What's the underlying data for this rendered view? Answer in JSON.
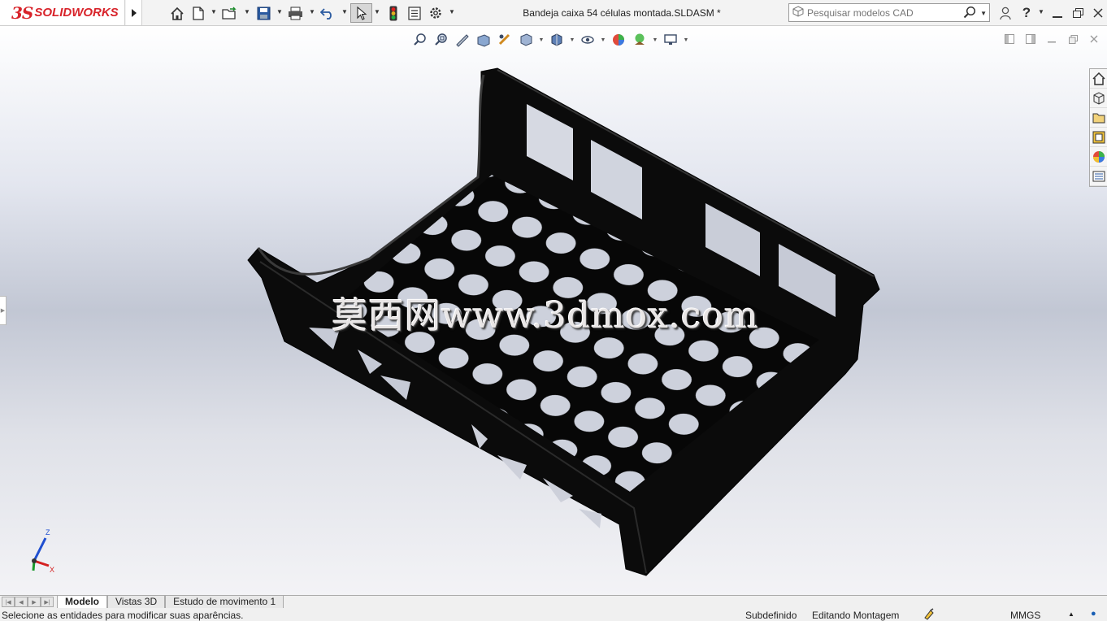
{
  "app": {
    "logo_ds": "3S",
    "logo_text": "SOLIDWORKS",
    "document_title": "Bandeja caixa 54 células montada.SLDASM *"
  },
  "toolbar": {
    "icons": [
      "home-icon",
      "new-document-icon",
      "open-icon",
      "save-icon",
      "print-icon",
      "undo-icon",
      "select-icon",
      "rebuild-icon",
      "file-properties-icon",
      "options-icon"
    ]
  },
  "search": {
    "placeholder": "Pesquisar modelos CAD"
  },
  "heads_up_toolbar": {
    "icons": [
      "zoom-to-fit-icon",
      "zoom-to-area-icon",
      "previous-view-icon",
      "section-view-icon",
      "dynamic-annotation-icon",
      "view-orientation-icon",
      "display-style-icon",
      "hide-show-items-icon",
      "edit-appearance-icon",
      "apply-scene-icon",
      "view-settings-icon"
    ]
  },
  "task_pane": {
    "icons": [
      "solidworks-resources-icon",
      "design-library-icon",
      "file-explorer-icon",
      "view-palette-icon",
      "appearances-icon",
      "custom-properties-icon"
    ]
  },
  "watermark": "莫西网www.3dmox.com",
  "triad": {
    "z_label": "Z",
    "x_label": "X",
    "colors": {
      "z": "#1f4fd0",
      "x": "#d42020",
      "y": "#1a9a2a"
    }
  },
  "tabs": [
    {
      "label": "Modelo",
      "active": true
    },
    {
      "label": "Vistas 3D",
      "active": false
    },
    {
      "label": "Estudo de movimento 1",
      "active": false
    }
  ],
  "status": {
    "message": "Selecione as entidades para modificar suas aparências.",
    "definition": "Subdefinido",
    "mode": "Editando Montagem",
    "units": "MMGS"
  },
  "colors": {
    "brand": "#d8232a",
    "model": "#0b0b0b"
  }
}
